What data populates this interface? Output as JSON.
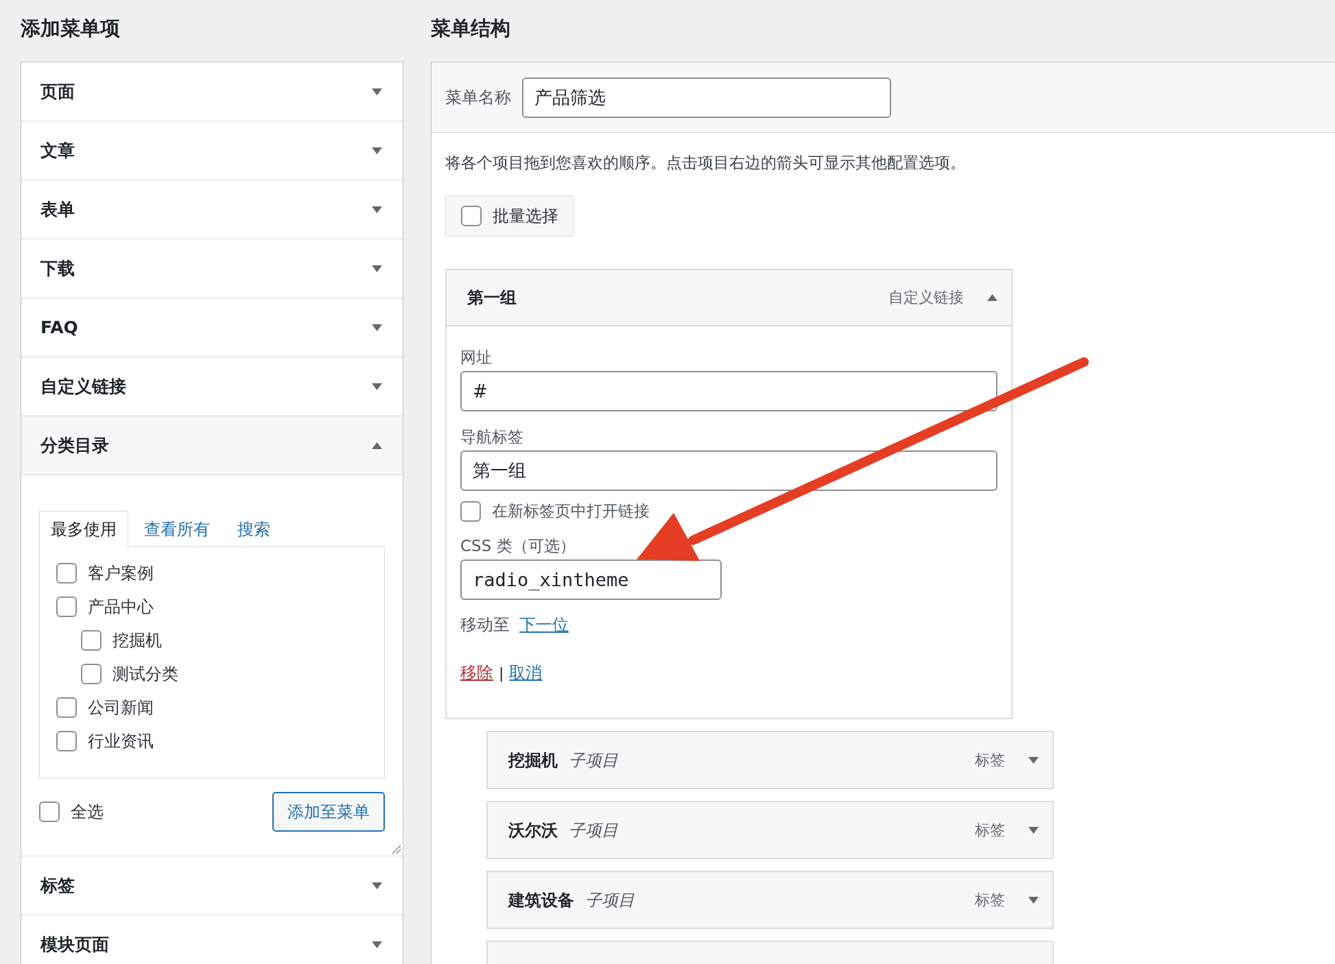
{
  "left": {
    "title": "添加菜单项",
    "sections": [
      {
        "label": "页面",
        "expanded": false
      },
      {
        "label": "文章",
        "expanded": false
      },
      {
        "label": "表单",
        "expanded": false
      },
      {
        "label": "下载",
        "expanded": false
      },
      {
        "label": "FAQ",
        "expanded": false
      },
      {
        "label": "自定义链接",
        "expanded": false
      },
      {
        "label": "分类目录",
        "expanded": true
      },
      {
        "label": "标签",
        "expanded": false
      },
      {
        "label": "模块页面",
        "expanded": false
      }
    ],
    "category_panel": {
      "tabs": [
        {
          "label": "最多使用",
          "selected": true
        },
        {
          "label": "查看所有",
          "selected": false
        },
        {
          "label": "搜索",
          "selected": false
        }
      ],
      "items": [
        {
          "label": "客户案例",
          "checked": false
        },
        {
          "label": "产品中心",
          "checked": false,
          "children": [
            {
              "label": "挖掘机",
              "checked": false
            },
            {
              "label": "测试分类",
              "checked": false
            }
          ]
        },
        {
          "label": "公司新闻",
          "checked": false
        },
        {
          "label": "行业资讯",
          "checked": false
        }
      ],
      "select_all": {
        "label": "全选",
        "checked": false
      },
      "add_button": "添加至菜单"
    }
  },
  "right": {
    "title": "菜单结构",
    "menu_name": {
      "label": "菜单名称",
      "value": "产品筛选"
    },
    "instructions": "将各个项目拖到您喜欢的顺序。点击项目右边的箭头可显示其他配置选项。",
    "bulk_select": {
      "label": "批量选择",
      "checked": false
    },
    "items": [
      {
        "title": "第一组",
        "type": "自定义链接",
        "expanded": true,
        "details": {
          "url_label": "网址",
          "url_value": "#",
          "nav_label": "导航标签",
          "nav_value": "第一组",
          "new_tab": {
            "label": "在新标签页中打开链接",
            "checked": false
          },
          "css_label": "CSS 类（可选）",
          "css_value": "radio_xintheme",
          "move_label": "移动至",
          "move_link": "下一位",
          "remove_link": "移除",
          "separator": "|",
          "cancel_link": "取消"
        },
        "children": [
          {
            "title": "挖掘机",
            "sub_label": "子项目",
            "type": "标签",
            "expanded": false
          },
          {
            "title": "沃尔沃",
            "sub_label": "子项目",
            "type": "标签",
            "expanded": false
          },
          {
            "title": "建筑设备",
            "sub_label": "子项目",
            "type": "标签",
            "expanded": false
          }
        ]
      }
    ],
    "more_items_below": true
  }
}
